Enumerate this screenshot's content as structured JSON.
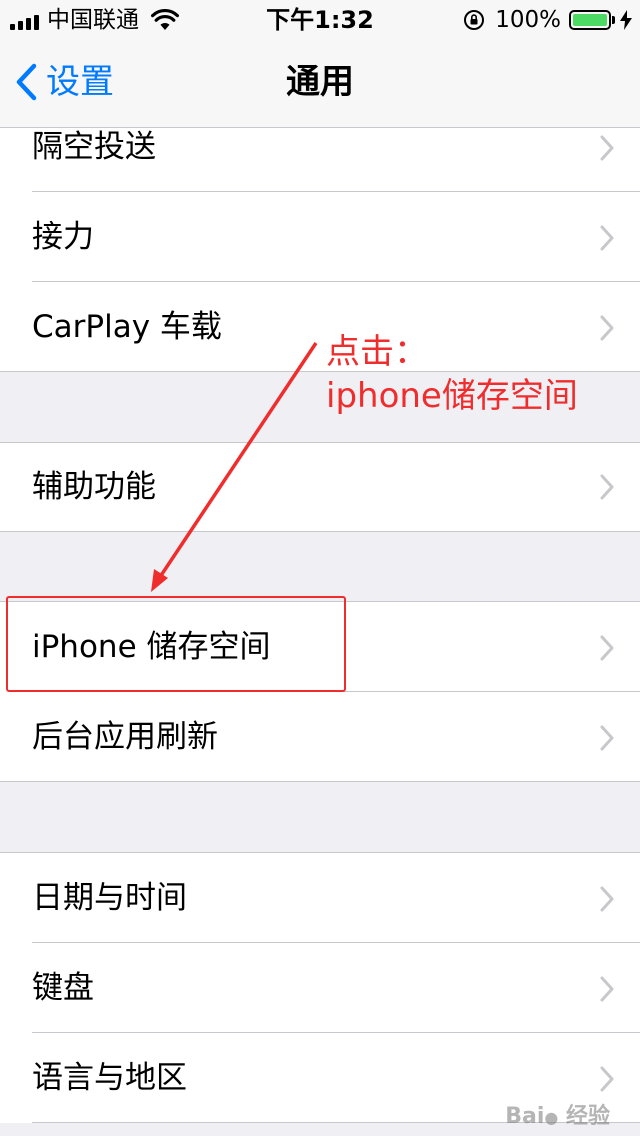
{
  "status_bar": {
    "carrier": "中国联通",
    "time": "下午1:32",
    "battery_percent": "100%",
    "battery_level": 1.0,
    "icons": [
      "signal-icon",
      "wifi-icon",
      "rotation-lock-icon",
      "battery-icon",
      "charging-icon"
    ]
  },
  "nav": {
    "back_label": "设置",
    "title": "通用"
  },
  "settings": {
    "airdrop": "隔空投送",
    "handoff": "接力",
    "carplay": "CarPlay 车载",
    "accessibility": "辅助功能",
    "iphone_storage": "iPhone 储存空间",
    "background_refresh": "后台应用刷新",
    "date_time": "日期与时间",
    "keyboard": "键盘",
    "language_region": "语言与地区"
  },
  "annotation": {
    "line1": "点击：",
    "line2": "iphone储存空间",
    "color": "#f02d2d"
  },
  "colors": {
    "accent": "#007aff",
    "group_background": "#efeff4",
    "separator": "#c8c7cc",
    "chevron": "#c7c7cc",
    "battery_green": "#4cd964"
  }
}
